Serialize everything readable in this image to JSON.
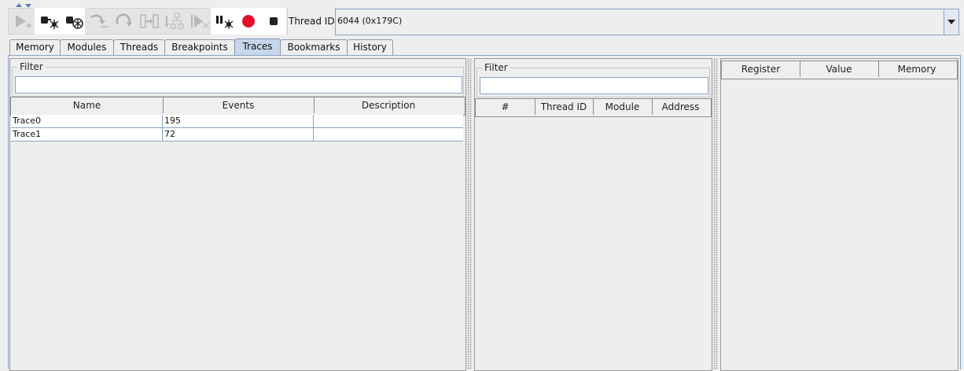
{
  "toolbar": {
    "buttons": [
      {
        "icon": "resume-icon",
        "enabled": false
      },
      {
        "icon": "attach-icon",
        "enabled": true
      },
      {
        "icon": "detach-icon",
        "enabled": true
      },
      {
        "icon": "step-over-icon",
        "enabled": false
      },
      {
        "icon": "step-back-icon",
        "enabled": false
      },
      {
        "icon": "step-into-icon",
        "enabled": false
      },
      {
        "icon": "step-hierarchy-icon",
        "enabled": false
      },
      {
        "icon": "run-to-icon",
        "enabled": false
      },
      {
        "icon": "pause-icon",
        "enabled": true
      },
      {
        "icon": "record-icon",
        "enabled": true
      },
      {
        "icon": "stop-icon",
        "enabled": true
      }
    ],
    "thread_label": "Thread ID",
    "thread_value": "6044 (0x179C)"
  },
  "tabs": [
    {
      "label": "Memory"
    },
    {
      "label": "Modules"
    },
    {
      "label": "Threads"
    },
    {
      "label": "Breakpoints"
    },
    {
      "label": "Traces",
      "active": true
    },
    {
      "label": "Bookmarks"
    },
    {
      "label": "History"
    }
  ],
  "traces_panel": {
    "filter_label": "Filter",
    "filter_value": "",
    "columns": [
      "Name",
      "Events",
      "Description"
    ],
    "rows": [
      {
        "name": "Trace0",
        "events": "195",
        "description": ""
      },
      {
        "name": "Trace1",
        "events": "72",
        "description": ""
      }
    ]
  },
  "events_panel": {
    "filter_label": "Filter",
    "filter_value": "",
    "columns": [
      "#",
      "Thread ID",
      "Module",
      "Address"
    ]
  },
  "registers_panel": {
    "columns": [
      "Register",
      "Value",
      "Memory"
    ]
  },
  "colors": {
    "record_red": "#e0102a",
    "active_tab": "#c6d6ec",
    "border_blue": "#8aa3c2"
  }
}
